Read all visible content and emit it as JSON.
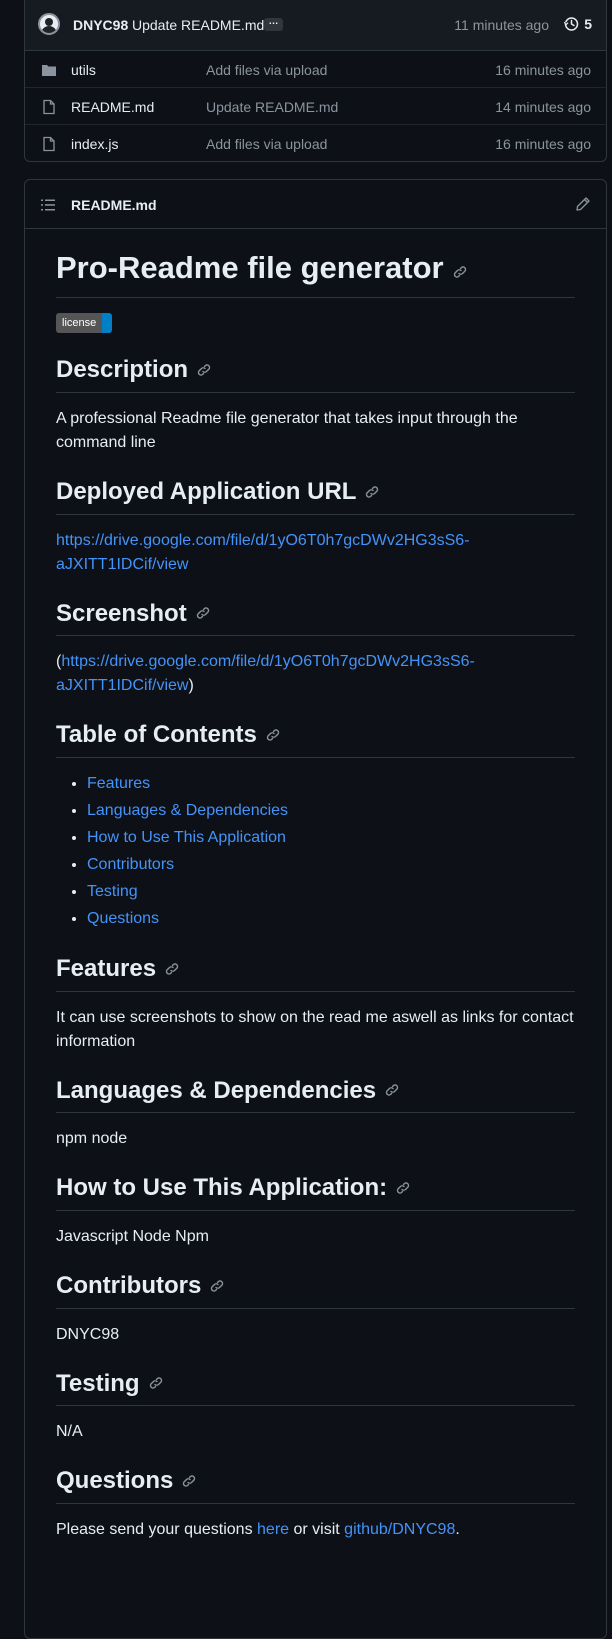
{
  "commit": {
    "author": "DNYC98",
    "message": "Update README.md",
    "ellipsis": "…",
    "time": "11 minutes ago",
    "history_count": "5"
  },
  "files": [
    {
      "name": "utils",
      "type": "folder",
      "message": "Add files via upload",
      "time": "16 minutes ago"
    },
    {
      "name": "README.md",
      "type": "file",
      "message": "Update README.md",
      "time": "14 minutes ago"
    },
    {
      "name": "index.js",
      "type": "file",
      "message": "Add files via upload",
      "time": "16 minutes ago"
    }
  ],
  "readme": {
    "filename": "README.md",
    "title": "Pro-Readme file generator",
    "badge_label": "license",
    "sections": {
      "description": {
        "heading": "Description",
        "text": "A professional Readme file generator that takes input through the command line"
      },
      "deployed": {
        "heading": "Deployed Application URL",
        "url": "https://drive.google.com/file/d/1yO6T0h7gcDWv2HG3sS6-aJXITT1IDCif/view"
      },
      "screenshot": {
        "heading": "Screenshot",
        "open": "(",
        "url": "https://drive.google.com/file/d/1yO6T0h7gcDWv2HG3sS6-aJXITT1IDCif/view",
        "close": ")"
      },
      "toc": {
        "heading": "Table of Contents",
        "items": [
          "Features",
          "Languages & Dependencies",
          "How to Use This Application",
          "Contributors",
          "Testing",
          "Questions"
        ]
      },
      "features": {
        "heading": "Features",
        "text": "It can use screenshots to show on the read me aswell as links for contact information"
      },
      "languages": {
        "heading": "Languages & Dependencies",
        "text": "npm node"
      },
      "howto": {
        "heading": "How to Use This Application:",
        "text": "Javascript Node Npm"
      },
      "contributors": {
        "heading": "Contributors",
        "text": "DNYC98"
      },
      "testing": {
        "heading": "Testing",
        "text": "N/A"
      },
      "questions": {
        "heading": "Questions",
        "text_before": "Please send your questions ",
        "link_here": "here",
        "text_middle": " or visit ",
        "link_github": "github/DNYC98",
        "text_after": "."
      }
    }
  },
  "colors": {
    "background": "#0d1117",
    "border": "#30363d",
    "text": "#e6edf3",
    "muted": "#8b949e",
    "link": "#4493f8"
  },
  "icons": [
    "avatar",
    "history-icon",
    "folder-icon",
    "file-icon",
    "list-icon",
    "pencil-icon",
    "link-icon"
  ]
}
